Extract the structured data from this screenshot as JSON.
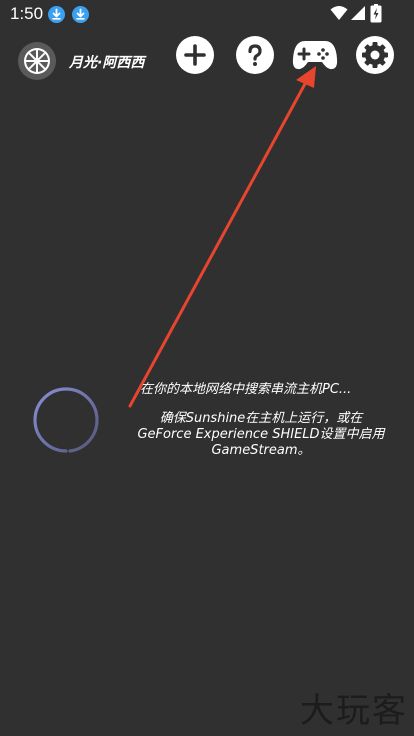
{
  "status_bar": {
    "time": "1:50",
    "icons": [
      "download-icon",
      "download-icon",
      "wifi-icon",
      "signal-icon",
      "battery-icon"
    ]
  },
  "header": {
    "username": "月光·阿西西",
    "buttons": [
      "add-icon",
      "help-icon",
      "gamepad-icon",
      "settings-icon"
    ]
  },
  "main": {
    "search_status": "在你的本地网络中搜索串流主机PC...",
    "hint": "确保Sunshine在主机上运行，或在\nGeForce Experience SHIELD设置中启用\nGameStream。"
  },
  "watermark": "大玩客",
  "colors": {
    "background": "#303030",
    "accent": "#3aa0f0",
    "arrow": "#e8452f",
    "spinner": "#8a8fd8"
  }
}
